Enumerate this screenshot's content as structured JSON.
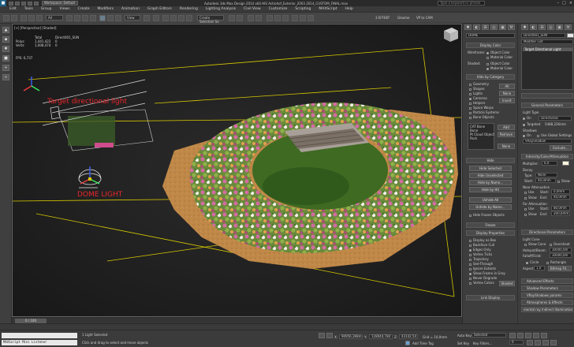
{
  "app": {
    "title": "Autodesk 3ds Max Design 2014 x64   HIS Astrohof_Exterior_2003 2014_CUSTOM_FINAL.max",
    "workspace": "Workspace: Default",
    "search_placeholder": "Type a keyword or phrase"
  },
  "menu": [
    "Edit",
    "Tools",
    "Group",
    "Views",
    "Create",
    "Modifiers",
    "Animation",
    "Graph Editors",
    "Rendering",
    "Lighting Analysis",
    "Civil View",
    "Customize",
    "Scripting",
    "MAXScript",
    "Help"
  ],
  "toolbar": {
    "selection_filter": "All",
    "view_dropdown": "View",
    "named_set": "Create Selection Se",
    "right_labels": [
      "3 EFFEKT",
      "Gloome",
      "VP to CAM"
    ]
  },
  "viewport": {
    "label": "[+] [Perspective] [Shaded]",
    "stats": {
      "header_total": "Total",
      "header_obj": "Direct001_SUN",
      "polys_label": "Polys:",
      "polys_value": "1,441,422",
      "polys_obj": "0",
      "verts_label": "Verts:",
      "verts_value": "1,008,474",
      "verts_obj": "0"
    },
    "fps": "FPS:   6,737",
    "annotations": {
      "target_light": "Target directional light",
      "dome_light": "DOME LIGHT"
    }
  },
  "command_panel": {
    "display_panel": {
      "object_name": "DOME",
      "display_color_title": "Display Color",
      "wireframe_label": "Wireframe:",
      "shaded_label": "Shaded:",
      "object_color": "Object Color",
      "material_color": "Material Color",
      "hide_by_category_title": "Hide by Category",
      "categories": [
        "Geometry",
        "Shapes",
        "Lights",
        "Cameras",
        "Helpers",
        "Space Warps",
        "Particle Systems",
        "Bone Objects"
      ],
      "all_btn": "All",
      "none_btn": "None",
      "invert_btn": "Invert",
      "list_items": [
        "CAT Bone",
        "Bone",
        "Pt Cloud Object",
        "Pack"
      ],
      "add_btn": "Add",
      "remove_btn": "Remove",
      "none_btn2": "None",
      "hide_title": "Hide",
      "hide_buttons": [
        "Hide Selected",
        "Hide Unselected",
        "Hide by Name...",
        "Hide by Hit",
        "Unhide All",
        "Unhide by Name..."
      ],
      "hide_frozen": "Hide Frozen Objects",
      "freeze_title": "Freeze",
      "display_properties_title": "Display Properties",
      "display_props": [
        "Display as Box",
        "Backface Cull",
        "Edges Only",
        "Vertex Ticks",
        "Trajectory",
        "See-Through",
        "Ignore Extents",
        "Show Frozen in Gray",
        "Never Degrade",
        "Vertex Colors"
      ],
      "shaded_btn": "Shaded",
      "link_display_title": "Link Display"
    },
    "modify_panel": {
      "object_name": "Direct001_SUN",
      "modifier_list": "Modifier List",
      "stack_item": "Target Directional Light",
      "general_title": "General Parameters",
      "light_type_label": "Light Type",
      "on_label": "On",
      "light_type_value": "Directional",
      "targeted_label": "Targeted",
      "targeted_value": "5488,226mm",
      "shadows_label": "Shadows",
      "shadow_on": "On",
      "use_global": "Use Global Settings",
      "shadow_type": "VRayShadow",
      "exclude_btn": "Exclude...",
      "intensity_title": "Intensity/Color/Attenuation",
      "multiplier_label": "Multiplier:",
      "multiplier_value": "6,0",
      "decay_label": "Decay",
      "decay_type_label": "Type:",
      "decay_type_value": "None",
      "decay_start_label": "Start:",
      "decay_start_value": "40,0mm",
      "show_label": "Show",
      "near_atten": "Near Attenuation",
      "far_atten": "Far Attenuation",
      "use_label": "Use",
      "start_label": "Start:",
      "end_label": "End:",
      "near_start": "0,0mm",
      "near_end": "40,0mm",
      "far_start": "80,0mm",
      "far_end": "200,0mm",
      "directional_title": "Directional Parameters",
      "light_cone": "Light Cone",
      "show_cone": "Show Cone",
      "overshoot": "Overshoot",
      "hotspot_label": "Hotspot/Beam:",
      "hotspot_value": "30000,0m",
      "falloff_label": "Falloff/Field:",
      "falloff_value": "30000,0m",
      "circle": "Circle",
      "rectangle": "Rectangle",
      "aspect_label": "Aspect:",
      "aspect_value": "1,0",
      "bitmap_fit": "Bitmap Fit...",
      "advanced_effects": "Advanced Effects",
      "shadow_params": "Shadow Parameters",
      "vrayshadow_params": "VRayShadows params",
      "atmospheres": "Atmospheres & Effects",
      "mental_ray": "mental ray Indirect Illumination"
    }
  },
  "timeline": {
    "slider": "0 / 100",
    "ticks": [
      "0",
      "5",
      "10",
      "15",
      "20",
      "25",
      "30",
      "35",
      "40",
      "45",
      "50",
      "55",
      "60",
      "65",
      "70",
      "75",
      "80",
      "85",
      "90",
      "95",
      "100"
    ]
  },
  "status": {
    "maxscript": "MAXScript Mini Listener",
    "selection": "1 Light Selected",
    "prompt": "Click and drag to select and move objects",
    "x_label": "X:",
    "x_value": "90956,398m",
    "y_label": "Y:",
    "y_value": "128044,784",
    "z_label": "Z:",
    "z_value": "43142,54",
    "grid": "Grid = 10,0mm",
    "add_time_tag": "Add Time Tag",
    "autokey": "Auto Key",
    "setkey": "Set Key",
    "key_mode": "Selected",
    "key_filters": "Key Filters...",
    "frame": "0"
  },
  "colors": {
    "accent": "#1f5f86",
    "annotation": "#e8262b",
    "ground": "#c08848",
    "viewport_bg": "#1e1e1e",
    "selection_yellow": "#d8c800"
  }
}
